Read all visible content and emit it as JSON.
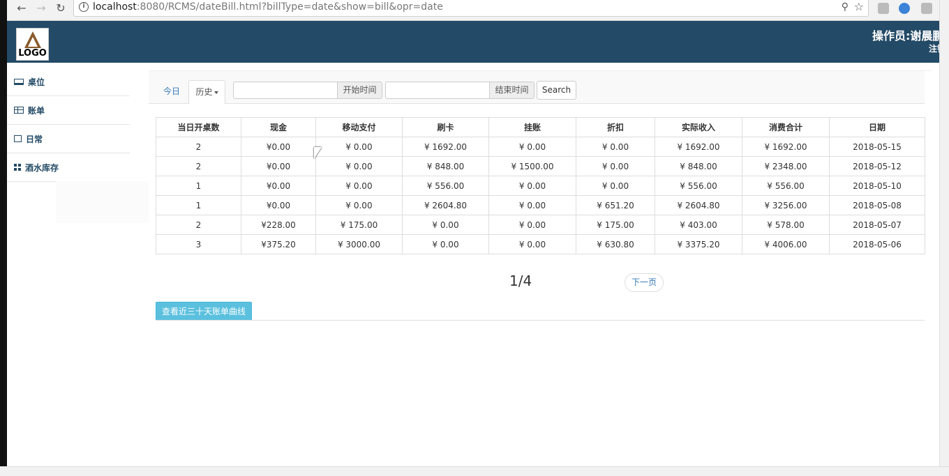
{
  "browser": {
    "url_host": "localhost",
    "url_rest": ":8080/RCMS/dateBill.html?billType=date&show=bill&opr=date"
  },
  "header": {
    "logo_text": "LOGO",
    "operator": "操作员:谢晨鹏",
    "logout": "注销"
  },
  "sidebar": {
    "items": [
      {
        "label": "桌位",
        "icon": "desktop-icon"
      },
      {
        "label": "账单",
        "icon": "table-icon"
      },
      {
        "label": "日常",
        "icon": "edit-icon"
      },
      {
        "label": "酒水库存",
        "icon": "grid-icon"
      }
    ]
  },
  "toolbar": {
    "tab_today": "今日",
    "tab_history": "历史",
    "start_value": "",
    "start_addon": "开始时间",
    "end_value": "",
    "end_addon": "结束时间",
    "search_label": "Search"
  },
  "table": {
    "headers": [
      "当日开桌数",
      "现金",
      "移动支付",
      "刷卡",
      "挂账",
      "折扣",
      "实际收入",
      "消费合计",
      "日期"
    ],
    "rows": [
      [
        "2",
        "¥0.00",
        "¥ 0.00",
        "¥ 1692.00",
        "¥ 0.00",
        "¥ 0.00",
        "¥ 1692.00",
        "¥ 1692.00",
        "2018-05-15"
      ],
      [
        "2",
        "¥0.00",
        "¥ 0.00",
        "¥ 848.00",
        "¥ 1500.00",
        "¥ 0.00",
        "¥ 848.00",
        "¥ 2348.00",
        "2018-05-12"
      ],
      [
        "1",
        "¥0.00",
        "¥ 0.00",
        "¥ 556.00",
        "¥ 0.00",
        "¥ 0.00",
        "¥ 556.00",
        "¥ 556.00",
        "2018-05-10"
      ],
      [
        "1",
        "¥0.00",
        "¥ 0.00",
        "¥ 2604.80",
        "¥ 0.00",
        "¥ 651.20",
        "¥ 2604.80",
        "¥ 3256.00",
        "2018-05-08"
      ],
      [
        "2",
        "¥228.00",
        "¥ 175.00",
        "¥ 0.00",
        "¥ 0.00",
        "¥ 175.00",
        "¥ 403.00",
        "¥ 578.00",
        "2018-05-07"
      ],
      [
        "3",
        "¥375.20",
        "¥ 3000.00",
        "¥ 0.00",
        "¥ 0.00",
        "¥ 630.80",
        "¥ 3375.20",
        "¥ 4006.00",
        "2018-05-06"
      ]
    ]
  },
  "pager": {
    "page_text": "1/4",
    "next_label": "下一页"
  },
  "actions": {
    "curve_label": "查看近三十天账单曲线"
  }
}
